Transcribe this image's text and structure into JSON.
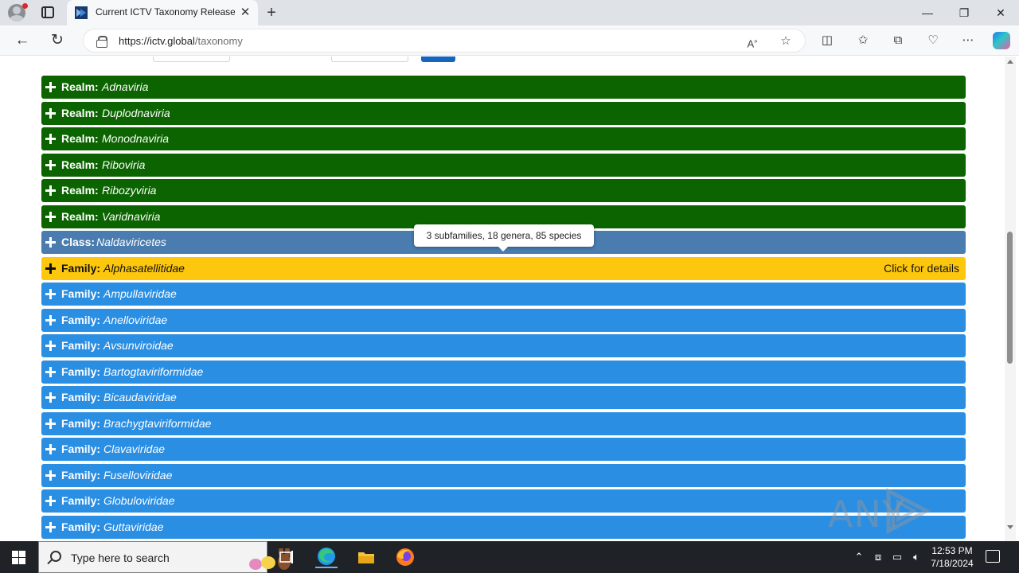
{
  "browser": {
    "tab_title": "Current ICTV Taxonomy Release |",
    "url_host": "https://ictv.global",
    "url_path": "/taxonomy",
    "tab_close": "✕",
    "new_tab": "+",
    "window_minimize": "—",
    "window_restore": "❐",
    "window_close": "✕"
  },
  "rows": [
    {
      "rank": "Realm:",
      "taxon": "Adnaviria",
      "type": "realm"
    },
    {
      "rank": "Realm:",
      "taxon": "Duplodnaviria",
      "type": "realm"
    },
    {
      "rank": "Realm:",
      "taxon": "Monodnaviria",
      "type": "realm"
    },
    {
      "rank": "Realm:",
      "taxon": "Riboviria",
      "type": "realm"
    },
    {
      "rank": "Realm:",
      "taxon": "Ribozyviria",
      "type": "realm"
    },
    {
      "rank": "Realm:",
      "taxon": "Varidnaviria",
      "type": "realm"
    },
    {
      "rank": "Class:",
      "taxon": "Naldaviricetes",
      "type": "class"
    },
    {
      "rank": "Family:",
      "taxon": "Alphasatellitidae",
      "type": "family",
      "highlighted": true,
      "details": "Click for details"
    },
    {
      "rank": "Family:",
      "taxon": "Ampullaviridae",
      "type": "family"
    },
    {
      "rank": "Family:",
      "taxon": "Anelloviridae",
      "type": "family"
    },
    {
      "rank": "Family:",
      "taxon": "Avsunviroidae",
      "type": "family"
    },
    {
      "rank": "Family:",
      "taxon": "Bartogtaviriformidae",
      "type": "family"
    },
    {
      "rank": "Family:",
      "taxon": "Bicaudaviridae",
      "type": "family"
    },
    {
      "rank": "Family:",
      "taxon": "Brachygtaviriformidae",
      "type": "family"
    },
    {
      "rank": "Family:",
      "taxon": "Clavaviridae",
      "type": "family"
    },
    {
      "rank": "Family:",
      "taxon": "Fuselloviridae",
      "type": "family"
    },
    {
      "rank": "Family:",
      "taxon": "Globuloviridae",
      "type": "family"
    },
    {
      "rank": "Family:",
      "taxon": "Guttaviridae",
      "type": "family"
    }
  ],
  "tooltip": "3 subfamilies, 18 genera, 85 species",
  "watermark": "ANY RUN",
  "taskbar": {
    "search_placeholder": "Type here to search",
    "time": "12:53 PM",
    "date": "7/18/2024"
  },
  "colors": {
    "realm": "#0b6400",
    "class": "#4a7cb0",
    "family": "#2a8ee3",
    "highlight": "#fdc70d"
  }
}
